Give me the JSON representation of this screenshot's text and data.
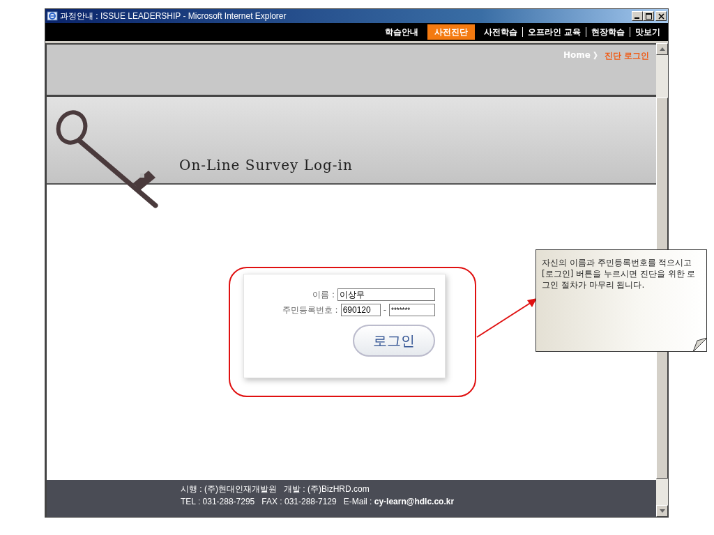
{
  "window": {
    "title": "과정안내 : ISSUE LEADERSHIP - Microsoft Internet Explorer"
  },
  "nav": [
    {
      "label": "학습안내",
      "selected": false
    },
    {
      "label": "사전진단",
      "selected": true
    },
    {
      "label": "사전학습",
      "selected": false
    },
    {
      "label": "오프라인 교육",
      "selected": false
    },
    {
      "label": "현장학습",
      "selected": false
    },
    {
      "label": "맛보기",
      "selected": false
    }
  ],
  "breadcrumb": {
    "home": "Home",
    "separator": "》",
    "current": "진단 로그인"
  },
  "banner": {
    "title": "On-Line Survey Log-in"
  },
  "login": {
    "name_label": "이름 :",
    "name_value": "이상무",
    "id_label": "주민등록번호 :",
    "id_first": "690120",
    "id_dash": "-",
    "id_second": "*******",
    "button": "로그인"
  },
  "callout": {
    "text": "자신의 이름과 주민등록번호를 적으시고 [로그인] 버튼을 누르시면 진단을 위한 로그인 절차가 마무리 됩니다."
  },
  "footer": {
    "line1": "시행 : (주)현대인재개발원   개발 : (주)BizHRD.com",
    "line2": "TEL : 031-288-7295   FAX : 031-288-7129   E-Mail : **cy-learn@hdlc.co.kr**"
  }
}
